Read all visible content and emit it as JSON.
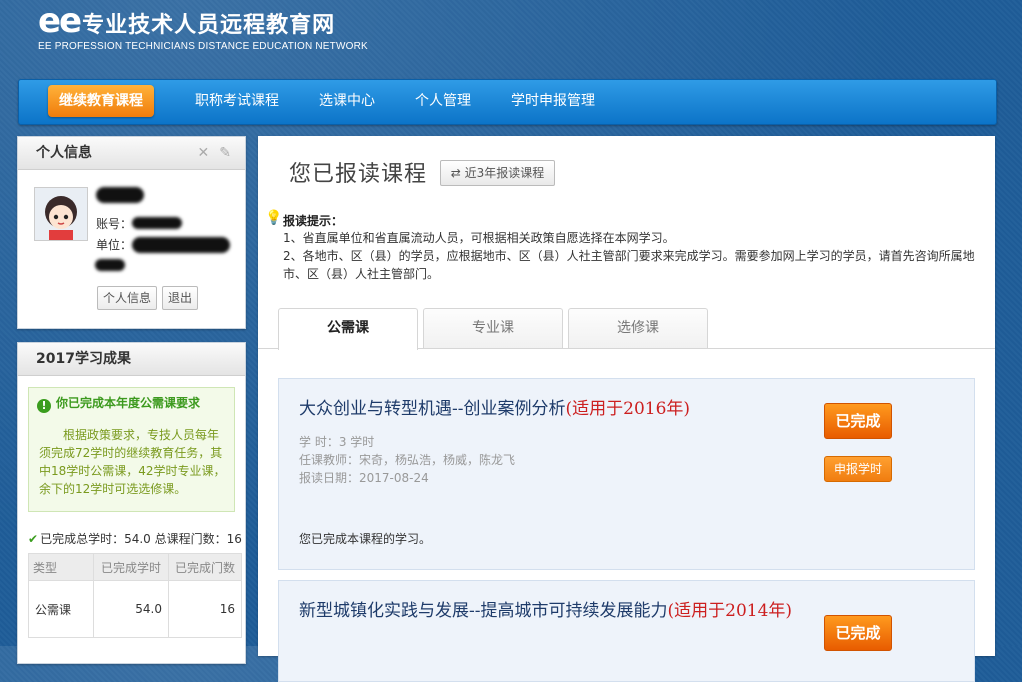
{
  "header": {
    "logo_ee": "ee",
    "logo_title": "专业技术人员远程教育网",
    "logo_subtitle": "EE PROFESSION TECHNICIANS DISTANCE EDUCATION NETWORK"
  },
  "nav": {
    "items": [
      "继续教育课程",
      "职称考试课程",
      "选课中心",
      "个人管理",
      "学时申报管理"
    ],
    "active_index": 0
  },
  "profile": {
    "title": "个人信息",
    "close_icon": "close-icon",
    "edit_icon": "pencil-icon",
    "account_label": "账号：",
    "unit_label": "单位：",
    "info_button": "个人信息",
    "logout_button": "退出"
  },
  "results": {
    "title": "2017学习成果",
    "notice_title": "你已完成本年度公需课要求",
    "notice_text": "根据政策要求，专技人员每年须完成72学时的继续教育任务，其中18学时公需课，42学时专业课，余下的12学时可选选修课。",
    "summary": "已完成总学时：54.0 总课程门数：16",
    "table": {
      "headers": [
        "类型",
        "已完成学时",
        "已完成门数"
      ],
      "rows": [
        [
          "公需课",
          "54.0",
          "16"
        ]
      ]
    }
  },
  "main": {
    "title": "您已报读课程",
    "recent_button": "近3年报读课程",
    "tip_title": "报读提示：",
    "tip_lines": [
      "1、省直属单位和省直属流动人员，可根据相关政策自愿选择在本网学习。",
      "2、各地市、区（县）的学员，应根据地市、区（县）人社主管部门要求来完成学习。需要参加网上学习的学员，请首先咨询所属地",
      "市、区（县）人社主管部门。"
    ],
    "tabs": [
      "公需课",
      "专业课",
      "选修课"
    ],
    "active_tab": 0,
    "courses": [
      {
        "title": "大众创业与转型机遇--创业案例分析",
        "tag": "(适用于2016年)",
        "hours": "学 时：3 学时",
        "teachers": "任课教师：宋奇，杨弘浩，杨威，陈龙飞",
        "date": "报读日期：2017-08-24",
        "status": "您已完成本课程的学习。",
        "done_button": "已完成",
        "report_button": "申报学时"
      },
      {
        "title": "新型城镇化实践与发展--提高城市可持续发展能力",
        "tag": "(适用于2014年)",
        "done_button": "已完成"
      }
    ]
  }
}
